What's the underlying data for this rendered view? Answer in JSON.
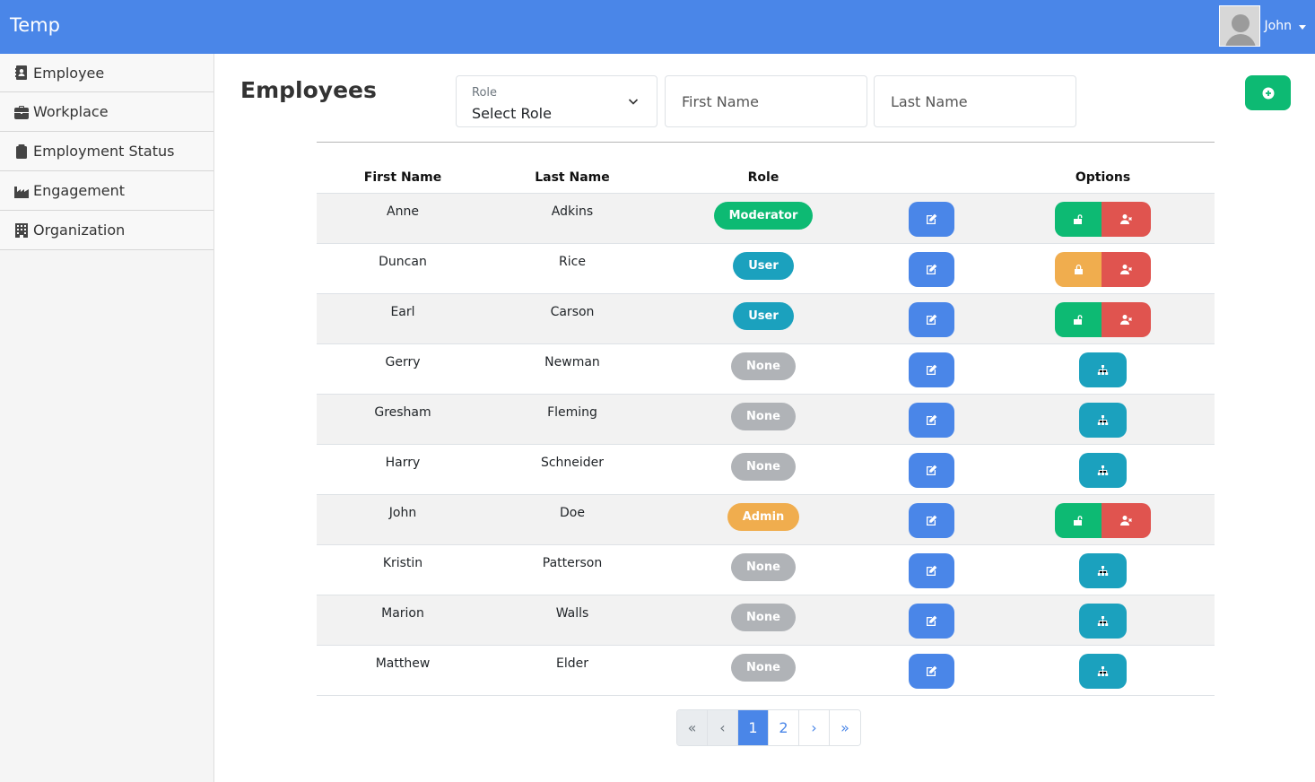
{
  "app": {
    "brand": "Temp"
  },
  "user": {
    "name": "John"
  },
  "sidebar": {
    "items": [
      {
        "label": "Employee",
        "icon": "address-card-icon"
      },
      {
        "label": "Workplace",
        "icon": "briefcase-icon"
      },
      {
        "label": "Employment Status",
        "icon": "clipboard-icon"
      },
      {
        "label": "Engagement",
        "icon": "industry-icon"
      },
      {
        "label": "Organization",
        "icon": "building-icon"
      }
    ]
  },
  "page": {
    "title": "Employees"
  },
  "filters": {
    "role_label": "Role",
    "role_value": "Select Role",
    "first_name_placeholder": "First Name",
    "last_name_placeholder": "Last Name"
  },
  "table": {
    "headers": [
      "First Name",
      "Last Name",
      "Role",
      "",
      "Options"
    ],
    "rows": [
      {
        "first": "Anne",
        "last": "Adkins",
        "role": "Moderator",
        "options": "account"
      },
      {
        "first": "Duncan",
        "last": "Rice",
        "role": "User",
        "options": "account-locked"
      },
      {
        "first": "Earl",
        "last": "Carson",
        "role": "User",
        "options": "account"
      },
      {
        "first": "Gerry",
        "last": "Newman",
        "role": "None",
        "options": "hierarchy"
      },
      {
        "first": "Gresham",
        "last": "Fleming",
        "role": "None",
        "options": "hierarchy"
      },
      {
        "first": "Harry",
        "last": "Schneider",
        "role": "None",
        "options": "hierarchy"
      },
      {
        "first": "John",
        "last": "Doe",
        "role": "Admin",
        "options": "account"
      },
      {
        "first": "Kristin",
        "last": "Patterson",
        "role": "None",
        "options": "hierarchy"
      },
      {
        "first": "Marion",
        "last": "Walls",
        "role": "None",
        "options": "hierarchy"
      },
      {
        "first": "Matthew",
        "last": "Elder",
        "role": "None",
        "options": "hierarchy"
      }
    ]
  },
  "pagination": {
    "first": "«",
    "prev": "‹",
    "pages": [
      "1",
      "2"
    ],
    "current": "1",
    "next": "›",
    "last": "»"
  },
  "colors": {
    "primary": "#4a86e8",
    "success": "#0dba73",
    "info": "#1ba1be",
    "warning": "#f0ad4e",
    "danger": "#e0544f",
    "muted": "#b0b3b7"
  }
}
